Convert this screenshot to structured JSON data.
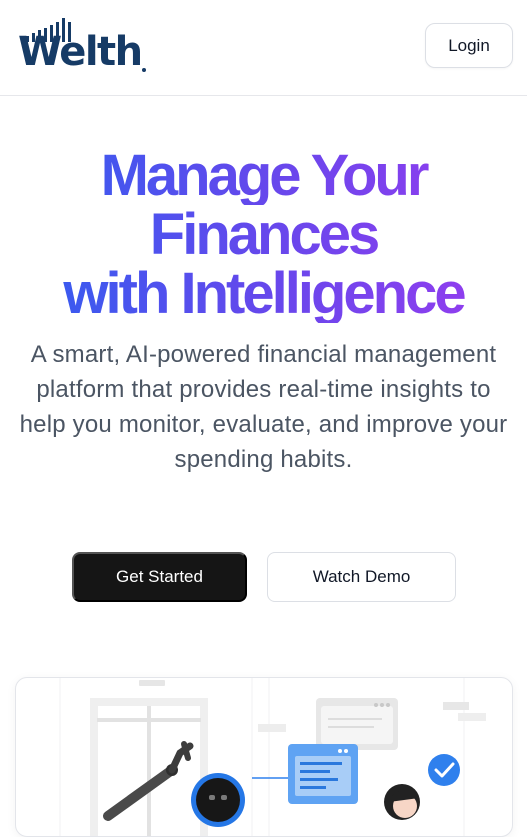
{
  "header": {
    "logo_text": "Welth",
    "login_label": "Login"
  },
  "hero": {
    "title_lines": [
      "Manage Your",
      "Finances",
      "with Intelligence"
    ],
    "subtitle": "A smart, AI-powered financial management platform that provides real-time insights to help you monitor, evaluate, and improve your spending habits."
  },
  "actions": {
    "primary_label": "Get Started",
    "secondary_label": "Watch Demo"
  },
  "colors": {
    "brand": "#163b66",
    "gradient_start": "#2f5ff0",
    "gradient_end": "#9a3bef",
    "primary_button": "#151515",
    "checkmark_badge": "#2f80ed"
  },
  "icons": {
    "checkmark": "check-badge-icon",
    "robot": "robot-icon",
    "robotic_arm": "robotic-arm-icon"
  }
}
